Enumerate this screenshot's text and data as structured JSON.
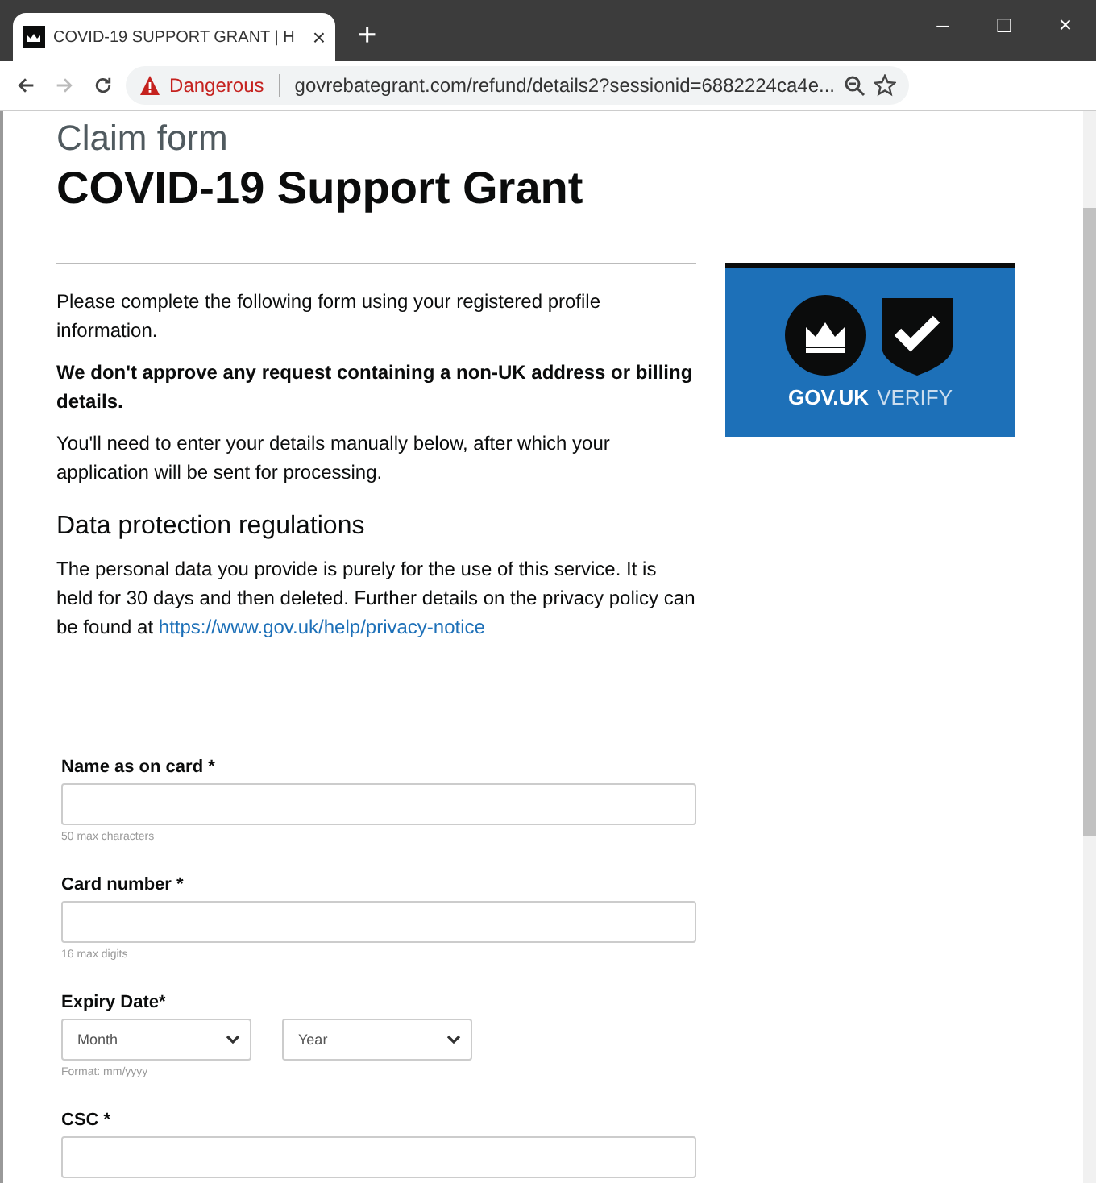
{
  "browser": {
    "tab": {
      "title": "COVID-19 SUPPORT GRANT | H",
      "close": "×",
      "selected": true
    },
    "new_tab": "+",
    "window_controls": [
      "–",
      "□",
      "×"
    ],
    "address": {
      "security": "Dangerous",
      "url": "govrebategrant.com/refund/details2?sessionid=6882224ca4e..."
    }
  },
  "page": {
    "caption": "Claim form",
    "heading": "COVID-19 Support Grant",
    "paragraphs": [
      {
        "text": "Please complete the following form using your registered profile information.",
        "bold": false
      },
      {
        "text": "We don't approve any request containing a non-UK address or billing details.",
        "bold": true
      },
      {
        "text": "You'll need to enter your details manually below, after which your application will be sent for processing.",
        "bold": false
      }
    ],
    "section_title": "Data protection regulations",
    "privacy": {
      "text": "The personal data you provide is purely for the use of this service. It is held for 30 days and then deleted. Further details on the privacy policy can be found at ",
      "link": "https://www.gov.uk/help/privacy-notice"
    },
    "logo": {
      "brand": "GOV.UK",
      "product": "VERIFY"
    },
    "form": [
      {
        "kind": "text",
        "label": "Name as on card *",
        "hint": "50 max characters"
      },
      {
        "kind": "text",
        "label": "Card number *",
        "hint": "16 max digits"
      },
      {
        "kind": "selects",
        "label": "Expiry Date*",
        "selects": [
          "Month",
          "Year"
        ],
        "hint": "Format: mm/yyyy"
      },
      {
        "kind": "text",
        "label": "CSC *"
      }
    ]
  }
}
